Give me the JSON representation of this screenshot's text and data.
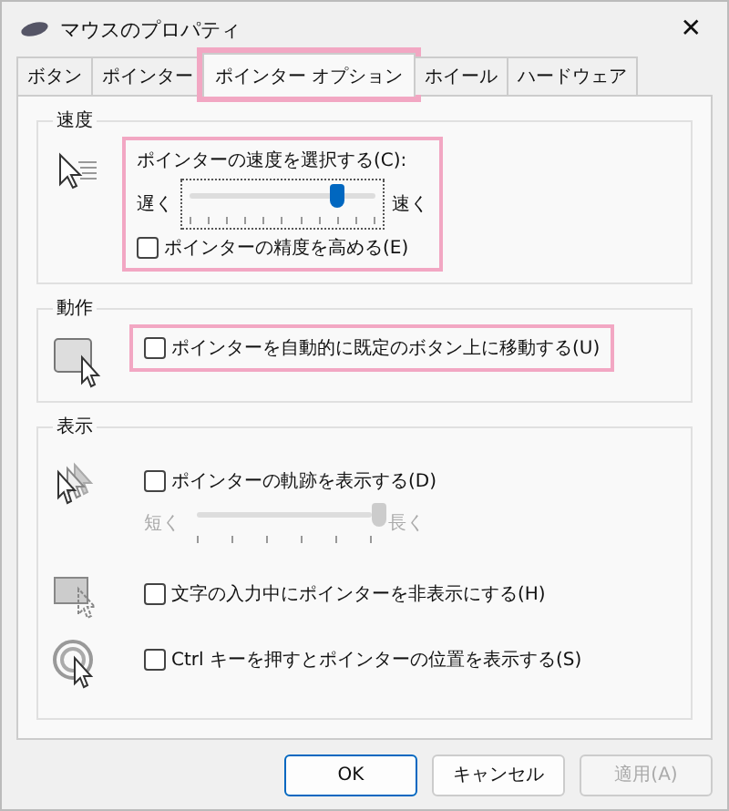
{
  "window": {
    "title": "マウスのプロパティ",
    "close": "✕"
  },
  "tabs": [
    {
      "label": "ボタン",
      "selected": false,
      "highlighted": false
    },
    {
      "label": "ポインター",
      "selected": false,
      "highlighted": false
    },
    {
      "label": "ポインター オプション",
      "selected": true,
      "highlighted": true
    },
    {
      "label": "ホイール",
      "selected": false,
      "highlighted": false
    },
    {
      "label": "ハードウェア",
      "selected": false,
      "highlighted": false
    }
  ],
  "speed": {
    "title": "速度",
    "prompt": "ポインターの速度を選択する(C):",
    "slow": "遅く",
    "fast": "速く",
    "level": 0.77,
    "highlighted": true,
    "option": {
      "label": "ポインターの精度を高める(E)",
      "checked": false
    }
  },
  "snap": {
    "title": "動作",
    "option": {
      "label": "ポインターを自動的に既定のボタン上に移動する(U)",
      "checked": false,
      "highlighted": true
    }
  },
  "visibility": {
    "title": "表示",
    "rows": [
      {
        "kind": "trail",
        "label": "ポインターの軌跡を表示する(D)",
        "checked": false,
        "short": "短く",
        "long": "長く",
        "level": 1,
        "disabled": true
      },
      {
        "kind": "hide",
        "label": "文字の入力中にポインターを非表示にする(H)",
        "checked": false
      },
      {
        "kind": "locate",
        "label": "Ctrl キーを押すとポインターの位置を表示する(S)",
        "checked": false
      }
    ]
  },
  "buttons": [
    {
      "label": "OK",
      "kind": "default",
      "disabled": false
    },
    {
      "label": "キャンセル",
      "kind": "normal",
      "disabled": false
    },
    {
      "label": "適用(A)",
      "kind": "normal",
      "disabled": true
    }
  ]
}
